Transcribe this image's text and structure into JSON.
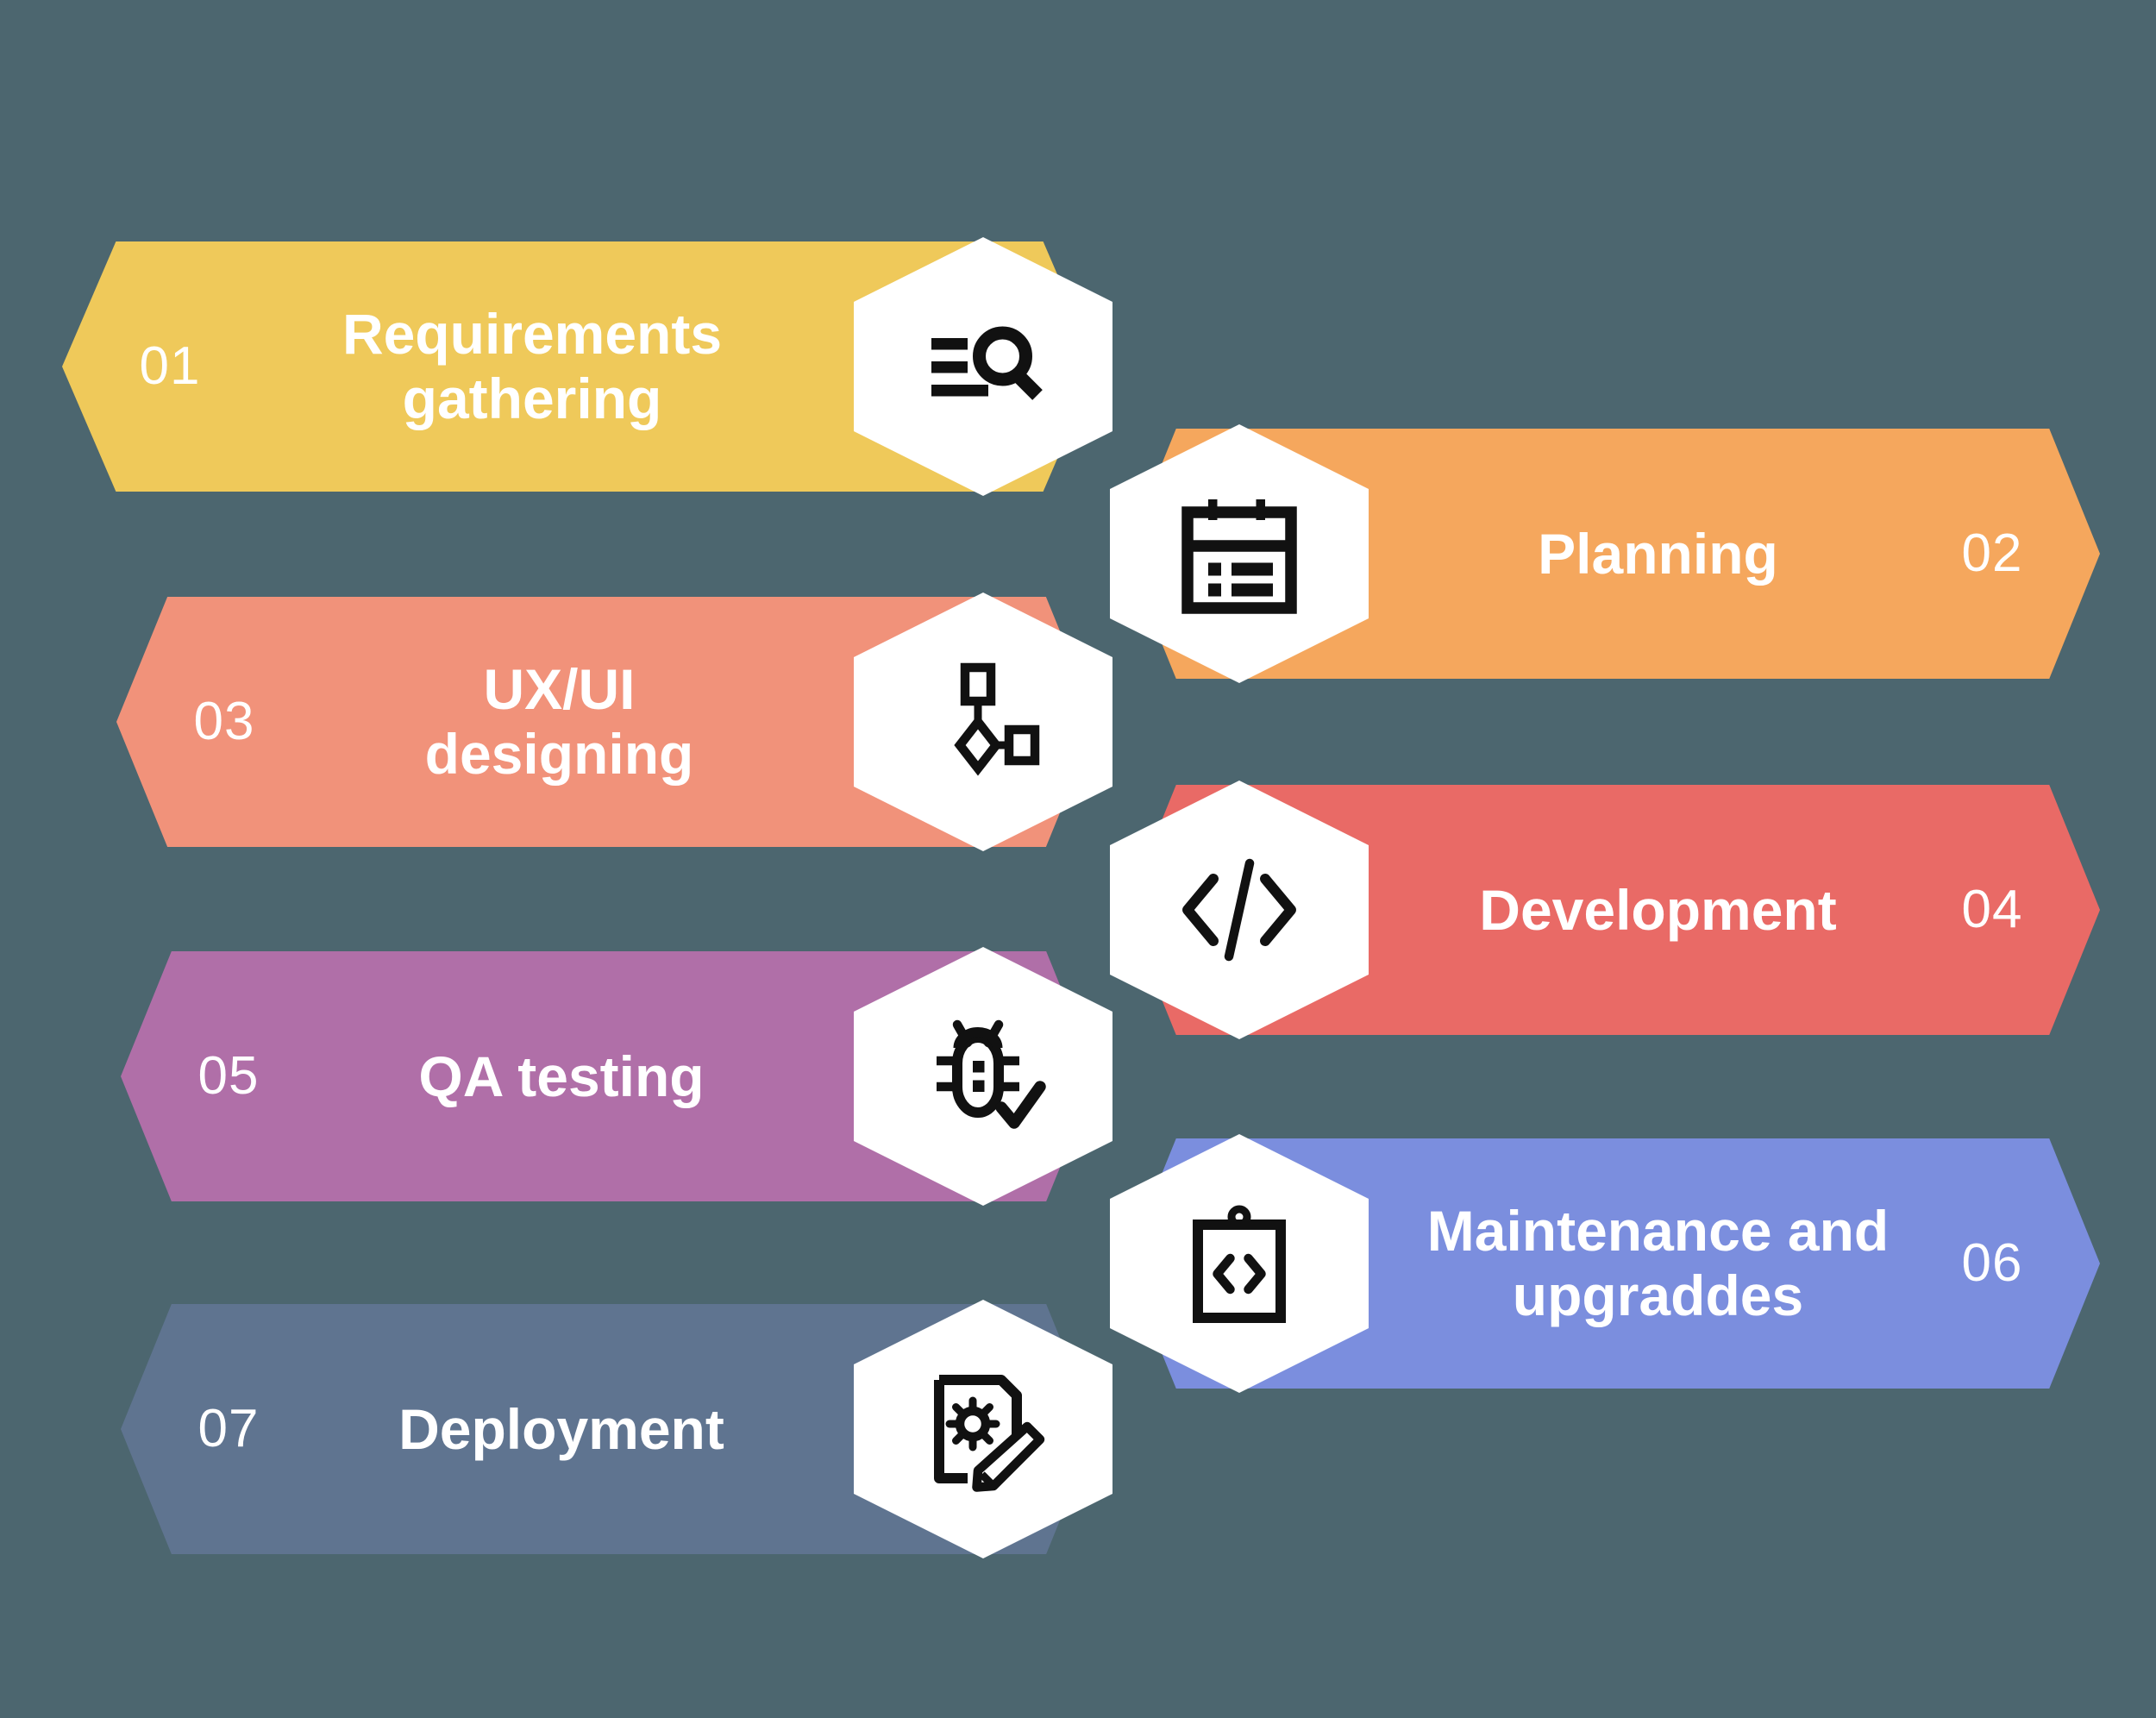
{
  "background_color": "#4c666f",
  "diagram": {
    "type": "process-steps-chevron",
    "steps": [
      {
        "number": "01",
        "label": "Requirements\ngathering",
        "label_lines": [
          "Requirements",
          "gathering"
        ],
        "color": "#efc95a",
        "side": "left",
        "icon": "requirements-search-icon"
      },
      {
        "number": "02",
        "label": "Planning",
        "label_lines": [
          "Planning"
        ],
        "color": "#f5a75d",
        "side": "right",
        "icon": "calendar-icon"
      },
      {
        "number": "03",
        "label": "UX/UI\ndesigning",
        "label_lines": [
          "UX/UI",
          "designing"
        ],
        "color": "#f1927a",
        "side": "left",
        "icon": "wireframe-flow-icon"
      },
      {
        "number": "04",
        "label": "Development",
        "label_lines": [
          "Development"
        ],
        "color": "#e96a66",
        "side": "right",
        "icon": "code-brackets-icon"
      },
      {
        "number": "05",
        "label": "QA testing",
        "label_lines": [
          "QA testing"
        ],
        "color": "#b06fa8",
        "side": "left",
        "icon": "bug-check-icon"
      },
      {
        "number": "06",
        "label": "Maintenance and\nupgraddes",
        "label_lines": [
          "Maintenance and",
          "upgraddes"
        ],
        "color": "#7b8ede",
        "side": "right",
        "icon": "clipboard-code-icon"
      },
      {
        "number": "07",
        "label": "Deployment",
        "label_lines": [
          "Deployment"
        ],
        "color": "#5f7490",
        "side": "left",
        "icon": "document-gear-pencil-icon"
      }
    ]
  }
}
